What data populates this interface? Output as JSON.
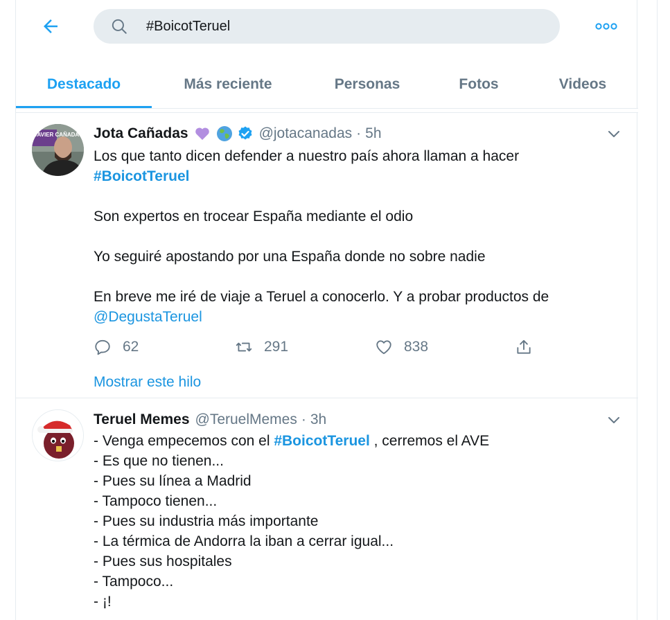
{
  "search": {
    "query": "#BoicotTeruel"
  },
  "tabs": [
    {
      "label": "Destacado",
      "active": true
    },
    {
      "label": "Más reciente",
      "active": false
    },
    {
      "label": "Personas",
      "active": false
    },
    {
      "label": "Fotos",
      "active": false
    },
    {
      "label": "Videos",
      "active": false
    }
  ],
  "icons": {
    "back": "arrow-left-icon",
    "search": "search-icon",
    "more": "more-dots-icon",
    "reply": "reply-icon",
    "retweet": "retweet-icon",
    "like": "heart-icon",
    "share": "share-icon",
    "caret": "chevron-down-icon"
  },
  "colors": {
    "accent": "#1da1f2",
    "link": "#1b95e0",
    "muted": "#657786",
    "text": "#14171a",
    "divider": "#e6ecf0"
  },
  "tweets": [
    {
      "name": "Jota Cañadas",
      "name_emojis": [
        "purple-heart-emoji",
        "globe-emoji"
      ],
      "verified": true,
      "handle": "@jotacanadas",
      "dot": "·",
      "time": "5h",
      "avatar_badge": "JAVIER CAÑADAS",
      "text": {
        "line1": "Los que tanto dicen defender a nuestro país ahora llaman a hacer",
        "hashtag1": "#BoicotTeruel",
        "para2": "Son expertos en trocear España mediante el odio",
        "para3": "Yo seguiré apostando por una España donde no sobre nadie",
        "para4": "En breve me iré de viaje a Teruel a conocerlo. Y a probar productos de",
        "mention": "@DegustaTeruel"
      },
      "replies": "62",
      "retweets": "291",
      "likes": "838",
      "thread_link": "Mostrar este hilo"
    },
    {
      "name": "Teruel Memes",
      "handle": "@TeruelMemes",
      "dot": "·",
      "time": "3h",
      "text": {
        "l1_pre": "- Venga empecemos con el ",
        "l1_hashtag": "#BoicotTeruel",
        "l1_post": " , cerremos el AVE",
        "l2": "- Es que no tienen...",
        "l3": "- Pues su línea a Madrid",
        "l4": "- Tampoco tienen...",
        "l5": "- Pues su industria más importante",
        "l6": "- La térmica de Andorra la iban a cerrar igual...",
        "l7": "- Pues sus hospitales",
        "l8": "- Tampoco...",
        "l9": "- ¡!"
      }
    }
  ]
}
